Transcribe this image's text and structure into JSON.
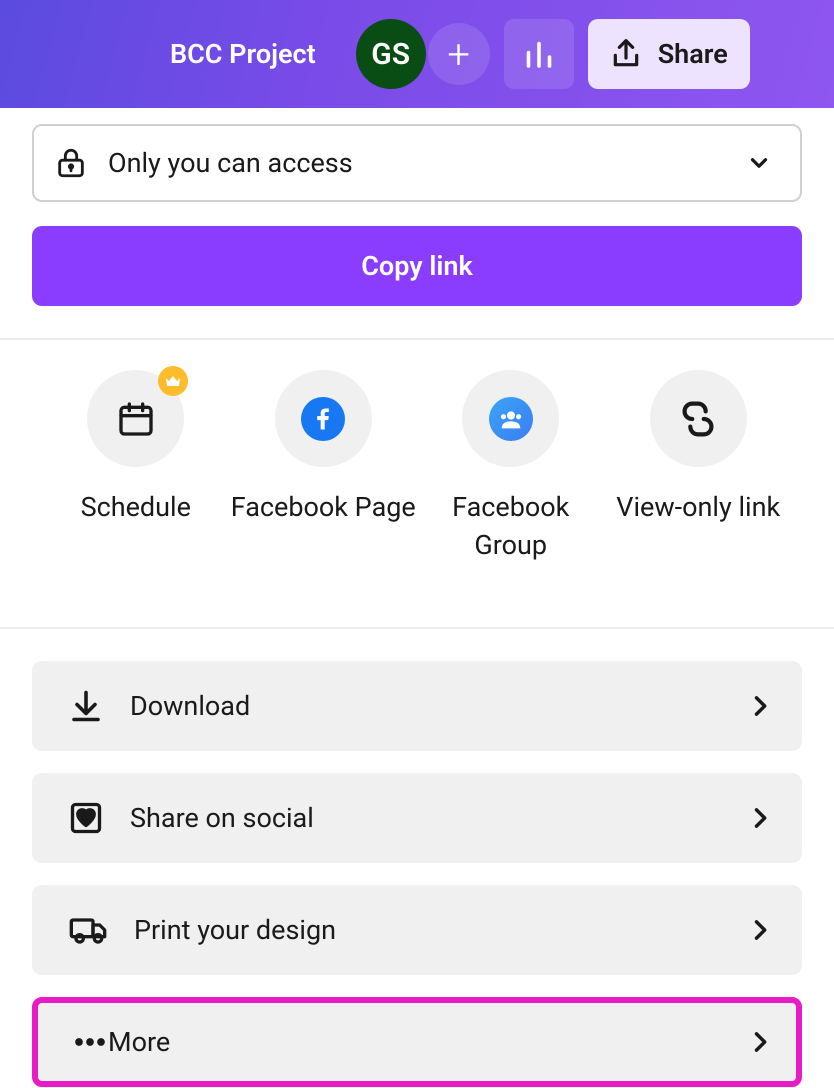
{
  "header": {
    "project_title": "BCC Project",
    "avatar_initials": "GS",
    "share_label": "Share"
  },
  "access": {
    "text": "Only you can access"
  },
  "copy_link": {
    "label": "Copy link"
  },
  "share_options": [
    {
      "label": "Schedule"
    },
    {
      "label": "Facebook Page"
    },
    {
      "label": "Facebook Group"
    },
    {
      "label": "View-only link"
    }
  ],
  "actions": [
    {
      "label": "Download"
    },
    {
      "label": "Share on social"
    },
    {
      "label": "Print your design"
    },
    {
      "label": "More"
    }
  ]
}
